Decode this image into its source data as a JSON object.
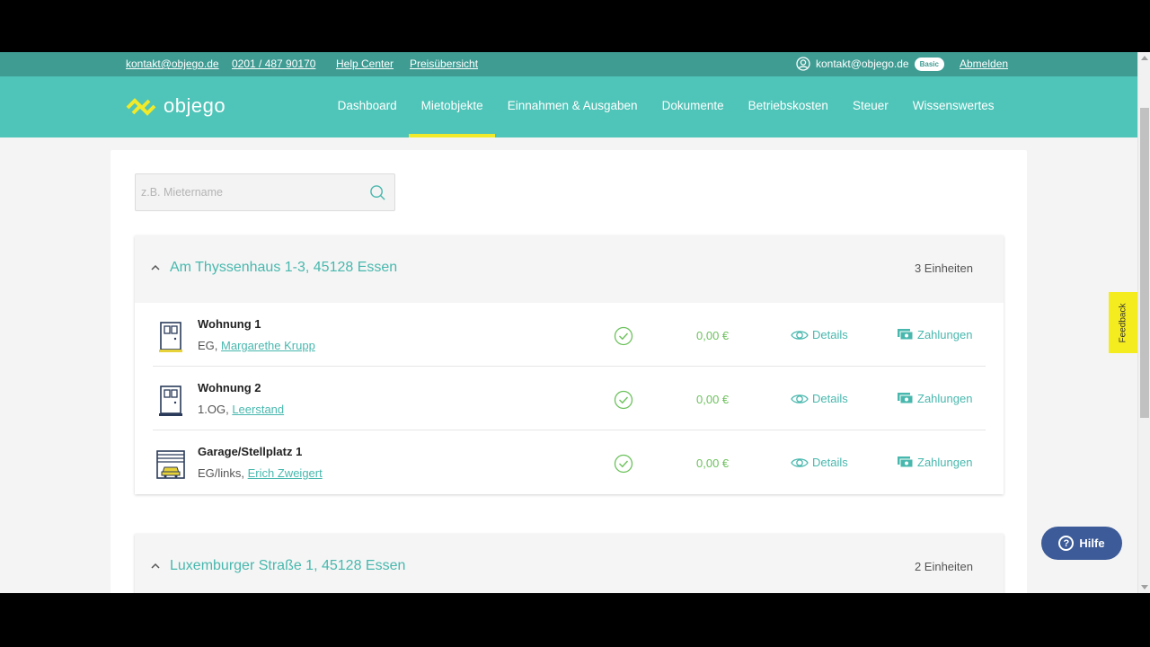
{
  "topbar": {
    "email": "kontakt@objego.de",
    "phone": "0201 / 487 90170",
    "help_center": "Help Center",
    "pricing": "Preisübersicht",
    "user_email": "kontakt@objego.de",
    "plan_badge": "Basic",
    "logout": "Abmelden"
  },
  "navbar": {
    "logo_text": "objego",
    "items": [
      {
        "label": "Dashboard",
        "active": false
      },
      {
        "label": "Mietobjekte",
        "active": true
      },
      {
        "label": "Einnahmen & Ausgaben",
        "active": false
      },
      {
        "label": "Dokumente",
        "active": false
      },
      {
        "label": "Betriebskosten",
        "active": false
      },
      {
        "label": "Steuer",
        "active": false
      },
      {
        "label": "Wissenswertes",
        "active": false
      }
    ]
  },
  "search": {
    "placeholder": "z.B. Mietername",
    "value": ""
  },
  "properties": [
    {
      "address": "Am Thyssenhaus 1-3, 45128 Essen",
      "unit_count": "3 Einheiten",
      "units": [
        {
          "name": "Wohnung 1",
          "location": "EG,",
          "tenant": "Margarethe Krupp",
          "amount": "0,00 €",
          "details": "Details",
          "payments": "Zahlungen",
          "icon": "door-icon"
        },
        {
          "name": "Wohnung 2",
          "location": "1.OG,",
          "tenant": "Leerstand",
          "amount": "0,00 €",
          "details": "Details",
          "payments": "Zahlungen",
          "icon": "door-icon"
        },
        {
          "name": "Garage/Stellplatz 1",
          "location": "EG/links,",
          "tenant": "Erich Zweigert",
          "amount": "0,00 €",
          "details": "Details",
          "payments": "Zahlungen",
          "icon": "garage-icon"
        }
      ]
    },
    {
      "address": "Luxemburger Straße 1, 45128 Essen",
      "unit_count": "2 Einheiten",
      "units": []
    }
  ],
  "feedback_label": "Feedback",
  "help_label": "Hilfe",
  "colors": {
    "topbar": "#3f9c93",
    "navbar": "#4fc4b8",
    "active_indicator": "#f1ea2a",
    "link": "#48b8ae",
    "amount": "#6cc25c",
    "help_button": "#3d5b98",
    "feedback": "#f4ec1f"
  }
}
